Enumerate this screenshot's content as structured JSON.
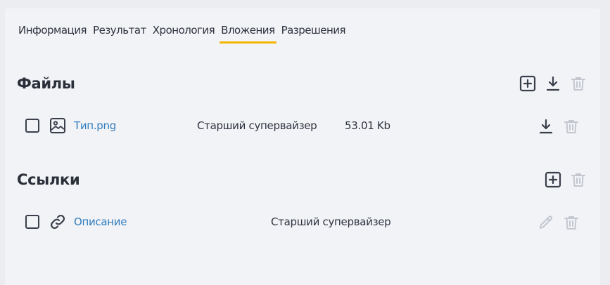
{
  "tabs": [
    {
      "label": "Информация"
    },
    {
      "label": "Результат"
    },
    {
      "label": "Хронология"
    },
    {
      "label": "Вложения",
      "active": true
    },
    {
      "label": "Разрешения"
    }
  ],
  "files": {
    "title": "Файлы",
    "items": [
      {
        "name": "Тип.png",
        "owner": "Старший супервайзер",
        "size": "53.01 Kb",
        "icon": "image-icon"
      }
    ]
  },
  "links": {
    "title": "Ссылки",
    "items": [
      {
        "name": "Описание",
        "owner": "Старший супервайзер",
        "icon": "link-icon"
      }
    ]
  },
  "colors": {
    "accent": "#f4b400",
    "link": "#2f7dbf",
    "icon_active": "#3a3f4c",
    "icon_disabled": "#c4c7cf"
  }
}
